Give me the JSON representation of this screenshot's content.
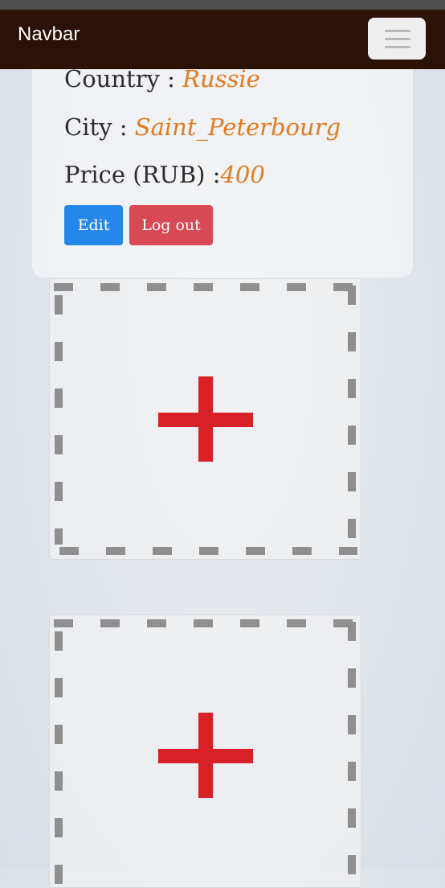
{
  "navbar": {
    "brand": "Navbar",
    "menu_icon": "hamburger-icon"
  },
  "profile": {
    "country_label": "Country : ",
    "country_value": "Russie",
    "city_label": "City : ",
    "city_value": "Saint_Peterbourg",
    "price_label": "Price (RUB) :",
    "price_value": "400"
  },
  "actions": {
    "edit_label": "Edit",
    "logout_label": "Log out"
  },
  "uploads": {
    "icon": "plus-icon",
    "count_visible": 2
  },
  "colors": {
    "navbar_bg": "#2b1106",
    "accent_value": "#e27a1f",
    "edit_button": "#2687ea",
    "logout_button": "#d64955",
    "plus": "#d82027",
    "dash": "#8f8f8f"
  }
}
